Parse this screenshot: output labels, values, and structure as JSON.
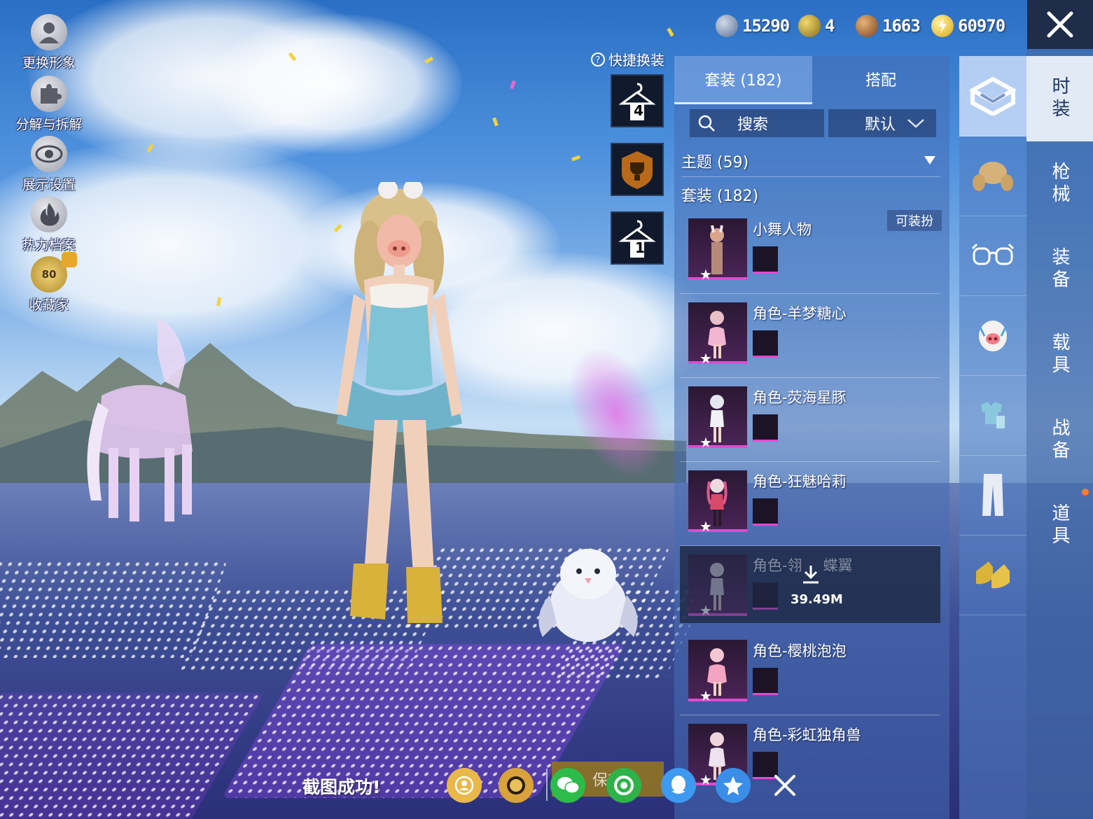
{
  "left_menu": [
    {
      "label": "更换形象",
      "icon": "person-silhouette-icon"
    },
    {
      "label": "分解与拆解",
      "icon": "puzzle-icon"
    },
    {
      "label": "展示设置",
      "icon": "eye-icon"
    },
    {
      "label": "热力档案",
      "icon": "flame-icon"
    },
    {
      "label": "收藏家",
      "icon": "collector-badge-icon",
      "badge": "80"
    }
  ],
  "currencies": [
    {
      "icon": "silver-coin-icon",
      "value": "15290",
      "color": "#8fa6c8"
    },
    {
      "icon": "gold-badge-icon",
      "value": "4",
      "color": "#b89a2c"
    },
    {
      "icon": "bronze-coin-icon",
      "value": "1663",
      "color": "#b5743a"
    },
    {
      "icon": "lightning-coin-icon",
      "value": "60970",
      "color": "#e8c22a"
    }
  ],
  "quick_change": {
    "label": "快捷换装",
    "slots": [
      {
        "icon": "hanger-icon",
        "number": "4"
      },
      {
        "icon": "trophy-icon",
        "number": ""
      },
      {
        "icon": "hanger-icon",
        "number": "1"
      }
    ]
  },
  "panel": {
    "tabs": [
      {
        "label": "套装 (182)",
        "active": true
      },
      {
        "label": "搭配",
        "active": false
      }
    ],
    "search_label": "搜索",
    "sort_label": "默认",
    "theme_header": "主题 (59)",
    "suit_header": "套装 (182)",
    "wearable_badge": "可装扮",
    "items": [
      {
        "name": "小舞人物",
        "dim": false,
        "download": ""
      },
      {
        "name": "角色-羊梦糖心",
        "dim": false,
        "download": ""
      },
      {
        "name": "角色-荧海星豚",
        "dim": false,
        "download": ""
      },
      {
        "name": "角色-狂魅哈莉",
        "dim": false,
        "download": ""
      },
      {
        "name": "角色-翎",
        "name_tail": "蝶翼",
        "dim": true,
        "download": "39.49M"
      },
      {
        "name": "角色-樱桃泡泡",
        "dim": false,
        "download": ""
      },
      {
        "name": "角色-彩虹独角兽",
        "dim": false,
        "download": ""
      }
    ]
  },
  "categories": [
    {
      "icon": "suit-box-icon",
      "active": true
    },
    {
      "icon": "hair-icon",
      "active": false
    },
    {
      "icon": "glasses-icon",
      "active": false
    },
    {
      "icon": "pig-mask-icon",
      "active": false
    },
    {
      "icon": "outfit-icon",
      "active": false
    },
    {
      "icon": "pants-icon",
      "active": false
    },
    {
      "icon": "shoes-icon",
      "active": false
    }
  ],
  "side_tabs": [
    {
      "label": "时装",
      "active": true
    },
    {
      "label": "枪械",
      "active": false
    },
    {
      "label": "装备",
      "active": false
    },
    {
      "label": "载具",
      "active": false
    },
    {
      "label": "战备",
      "active": false
    },
    {
      "label": "道具",
      "active": false
    }
  ],
  "bottom": {
    "toast": "截图成功!",
    "save_label": "保存",
    "share_items": [
      {
        "icon": "game-friend-icon",
        "color": "#e9b84a"
      },
      {
        "icon": "peace-elite-icon",
        "color": "#d9a23a"
      },
      {
        "icon": "wechat-icon",
        "color": "#2dbb4a"
      },
      {
        "icon": "moments-icon",
        "color": "#2fb24a"
      },
      {
        "icon": "qq-icon",
        "color": "#3d9af0"
      },
      {
        "icon": "qzone-icon",
        "color": "#3a8ee8"
      },
      {
        "icon": "close-icon",
        "color": "transparent"
      }
    ]
  }
}
